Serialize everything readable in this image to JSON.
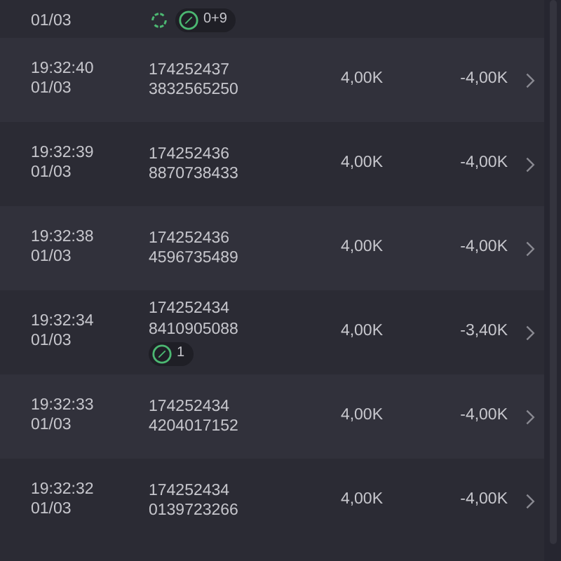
{
  "rows": [
    {
      "date": "01/03",
      "badges": [
        {
          "kind": "sync"
        },
        {
          "kind": "pill",
          "text": "0+9"
        }
      ]
    },
    {
      "time": "19:32:40",
      "date": "01/03",
      "id_line_1": "174252437",
      "id_line_2": "3832565250",
      "amount": "4,00K",
      "change": "-4,00K",
      "badges": []
    },
    {
      "time": "19:32:39",
      "date": "01/03",
      "id_line_1": "174252436",
      "id_line_2": "8870738433",
      "amount": "4,00K",
      "change": "-4,00K",
      "badges": []
    },
    {
      "time": "19:32:38",
      "date": "01/03",
      "id_line_1": "174252436",
      "id_line_2": "4596735489",
      "amount": "4,00K",
      "change": "-4,00K",
      "badges": []
    },
    {
      "time": "19:32:34",
      "date": "01/03",
      "id_line_1": "174252434",
      "id_line_2": "8410905088",
      "amount": "4,00K",
      "change": "-3,40K",
      "badges": [
        {
          "kind": "pill",
          "text": "1"
        }
      ]
    },
    {
      "time": "19:32:33",
      "date": "01/03",
      "id_line_1": "174252434",
      "id_line_2": "4204017152",
      "amount": "4,00K",
      "change": "-4,00K",
      "badges": []
    },
    {
      "time": "19:32:32",
      "date": "01/03",
      "id_line_1": "174252434",
      "id_line_2": "0139723266",
      "amount": "4,00K",
      "change": "-4,00K",
      "badges": []
    }
  ]
}
